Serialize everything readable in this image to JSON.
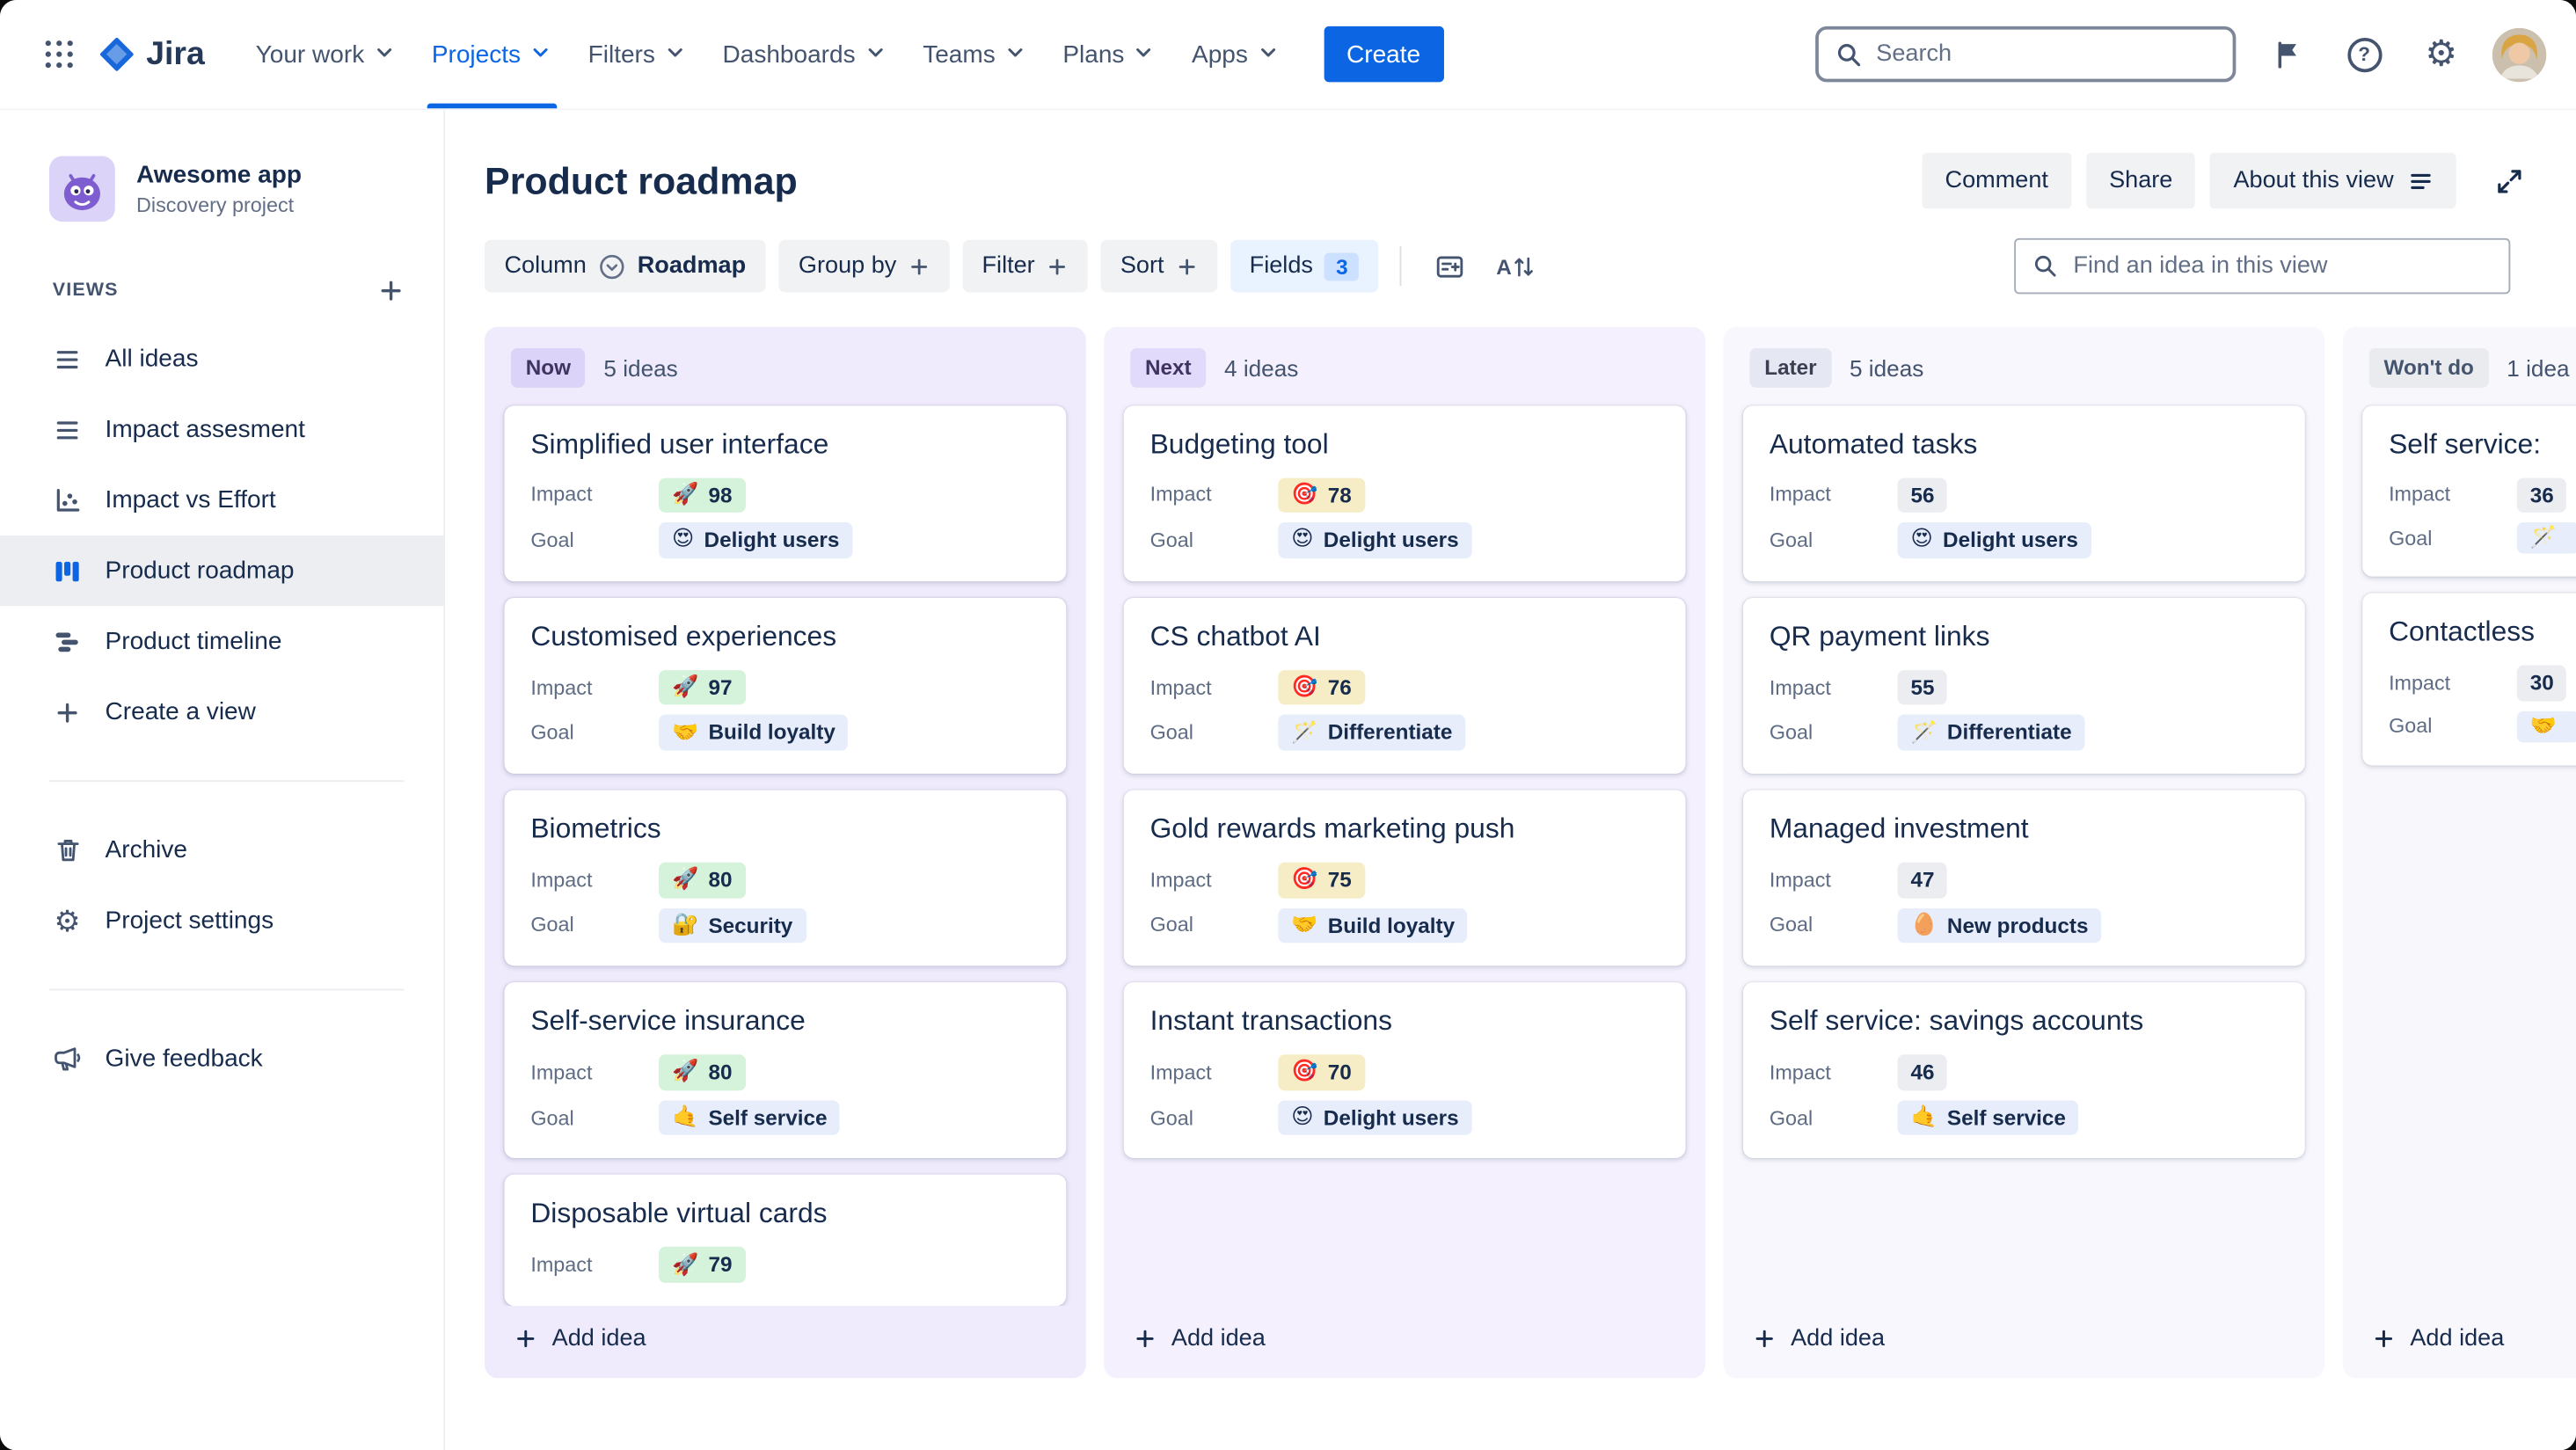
{
  "topnav": {
    "logo_text": "Jira",
    "items": [
      {
        "label": "Your work"
      },
      {
        "label": "Projects",
        "active": true
      },
      {
        "label": "Filters"
      },
      {
        "label": "Dashboards"
      },
      {
        "label": "Teams"
      },
      {
        "label": "Plans"
      },
      {
        "label": "Apps"
      }
    ],
    "create_label": "Create",
    "search_placeholder": "Search"
  },
  "sidebar": {
    "project_name": "Awesome app",
    "project_type": "Discovery project",
    "views_heading": "VIEWS",
    "views": [
      {
        "label": "All ideas"
      },
      {
        "label": "Impact assesment"
      },
      {
        "label": "Impact vs Effort"
      },
      {
        "label": "Product roadmap",
        "selected": true
      },
      {
        "label": "Product timeline"
      },
      {
        "label": "Create a view"
      }
    ],
    "archive_label": "Archive",
    "settings_label": "Project settings",
    "feedback_label": "Give feedback"
  },
  "header": {
    "title": "Product roadmap",
    "comment_label": "Comment",
    "share_label": "Share",
    "about_label": "About this view"
  },
  "toolbar": {
    "column_label": "Column",
    "column_value": "Roadmap",
    "group_by_label": "Group by",
    "filter_label": "Filter",
    "sort_label": "Sort",
    "fields_label": "Fields",
    "fields_count": "3",
    "find_placeholder": "Find an idea in this view"
  },
  "board": {
    "add_idea_label": "Add idea",
    "field_labels": {
      "impact": "Impact",
      "goal": "Goal"
    },
    "columns": [
      {
        "status": "Now",
        "count": "5 ideas",
        "tint": "#EFEAFC",
        "lozenge_bg": "#DCD3F8",
        "lozenge_text": "#3E3361",
        "impact_bg": "#D5F2DB",
        "cards": [
          {
            "title": "Simplified user interface",
            "impact_emoji": "🚀",
            "impact": "98",
            "goal_emoji": "😍",
            "goal": "Delight users"
          },
          {
            "title": "Customised experiences",
            "impact_emoji": "🚀",
            "impact": "97",
            "goal_emoji": "🤝",
            "goal": "Build loyalty"
          },
          {
            "title": "Biometrics",
            "impact_emoji": "🚀",
            "impact": "80",
            "goal_emoji": "🔐",
            "goal": "Security"
          },
          {
            "title": "Self-service insurance",
            "impact_emoji": "🚀",
            "impact": "80",
            "goal_emoji": "🤙",
            "goal": "Self service"
          },
          {
            "title": "Disposable virtual cards",
            "impact_emoji": "🚀",
            "impact": "79"
          }
        ]
      },
      {
        "status": "Next",
        "count": "4 ideas",
        "tint": "#F4F0FD",
        "lozenge_bg": "#E2DAFB",
        "lozenge_text": "#3E3361",
        "impact_bg": "#F6EDC6",
        "cards": [
          {
            "title": "Budgeting tool",
            "impact_emoji": "🎯",
            "impact": "78",
            "goal_emoji": "😍",
            "goal": "Delight users"
          },
          {
            "title": "CS chatbot AI",
            "impact_emoji": "🎯",
            "impact": "76",
            "goal_emoji": "🪄",
            "goal": "Differentiate"
          },
          {
            "title": "Gold rewards marketing push",
            "impact_emoji": "🎯",
            "impact": "75",
            "goal_emoji": "🤝",
            "goal": "Build loyalty"
          },
          {
            "title": "Instant transactions",
            "impact_emoji": "🎯",
            "impact": "70",
            "goal_emoji": "😍",
            "goal": "Delight users"
          }
        ]
      },
      {
        "status": "Later",
        "count": "5 ideas",
        "tint": "#F8F7FD",
        "lozenge_bg": "#E5E7F3",
        "lozenge_text": "#3B3F51",
        "impact_bg": "#ECEDF1",
        "cards": [
          {
            "title": "Automated tasks",
            "impact": "56",
            "goal_emoji": "😍",
            "goal": "Delight users"
          },
          {
            "title": "QR payment links",
            "impact": "55",
            "goal_emoji": "🪄",
            "goal": "Differentiate"
          },
          {
            "title": "Managed investment",
            "impact": "47",
            "goal_emoji": "🥚",
            "goal": "New products"
          },
          {
            "title": "Self service: savings accounts",
            "impact": "46",
            "goal_emoji": "🤙",
            "goal": "Self service"
          }
        ]
      },
      {
        "status": "Won't do",
        "count": "1 idea",
        "tint": "#F8F7FC",
        "lozenge_bg": "#EAEBEE",
        "lozenge_text": "#44546F",
        "impact_bg": "#ECEDF1",
        "cards": [
          {
            "title": "Self service:",
            "impact": "36",
            "goal_emoji": "🪄",
            "goal": ""
          },
          {
            "title": "Contactless",
            "impact": "30",
            "goal_emoji": "🤝",
            "goal": ""
          }
        ]
      }
    ]
  }
}
